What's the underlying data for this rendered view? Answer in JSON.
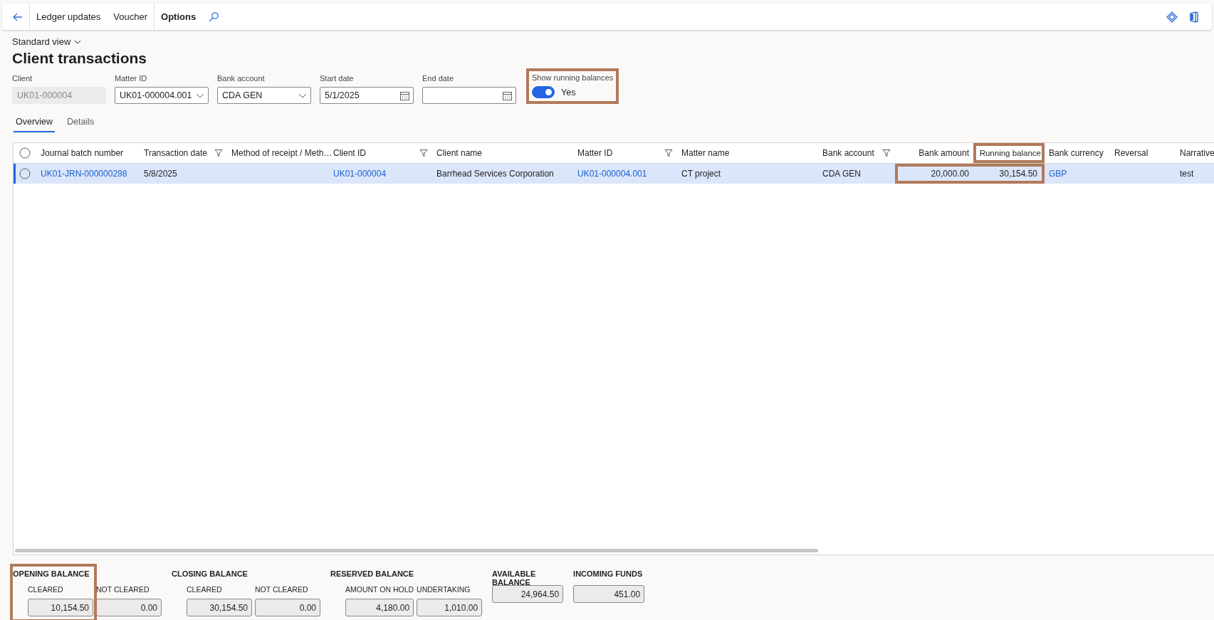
{
  "toolbar": {
    "items": [
      {
        "label": "Ledger updates",
        "kind": "action"
      },
      {
        "label": "Voucher",
        "kind": "action"
      },
      {
        "label": "Options",
        "kind": "menu"
      }
    ]
  },
  "view": {
    "label": "Standard view"
  },
  "title": "Client transactions",
  "filters": [
    {
      "label": "Client",
      "value": "UK01-000004",
      "kind": "readonly"
    },
    {
      "label": "Matter ID",
      "value": "UK01-000004.001",
      "kind": "dropdown"
    },
    {
      "label": "Bank account",
      "value": "CDA GEN",
      "kind": "dropdown"
    },
    {
      "label": "Start date",
      "value": "5/1/2025",
      "kind": "date"
    },
    {
      "label": "End date",
      "kind": "date"
    }
  ],
  "running_balances": {
    "label": "Show running balances",
    "on": true,
    "state_text": "Yes",
    "highlighted": true
  },
  "tabs": [
    {
      "label": "Overview",
      "selected": true
    },
    {
      "label": "Details",
      "selected": false
    }
  ],
  "table": {
    "all_selected": false,
    "columns": [
      {
        "label": "Journal batch number",
        "filter": false,
        "numeric": false,
        "highlighted": false
      },
      {
        "label": "Transaction date",
        "filter": true,
        "numeric": false,
        "highlighted": false
      },
      {
        "label": "Method of receipt / Meth…",
        "filter": false,
        "numeric": false,
        "highlighted": false
      },
      {
        "label": "Client ID",
        "filter": true,
        "numeric": false,
        "highlighted": false
      },
      {
        "label": "Client name",
        "filter": false,
        "numeric": false,
        "highlighted": false
      },
      {
        "label": "Matter ID",
        "filter": true,
        "numeric": false,
        "highlighted": false
      },
      {
        "label": "Matter name",
        "filter": false,
        "numeric": false,
        "highlighted": false
      },
      {
        "label": "Bank account",
        "filter": true,
        "numeric": false,
        "highlighted": false
      },
      {
        "label": "Bank amount",
        "filter": false,
        "numeric": true,
        "highlighted": false
      },
      {
        "label": "Running balance",
        "filter": false,
        "numeric": true,
        "highlighted": true
      },
      {
        "label": "Bank currency",
        "filter": false,
        "numeric": false,
        "highlighted": false
      },
      {
        "label": "Reversal",
        "filter": false,
        "numeric": false,
        "highlighted": false
      },
      {
        "label": "Narrative",
        "filter": false,
        "numeric": false,
        "highlighted": false
      }
    ],
    "rows": [
      {
        "selected": true,
        "cells": [
          {
            "text": "UK01-JRN-000000298",
            "link": true,
            "highlighted": false
          },
          {
            "text": "5/8/2025",
            "link": false,
            "highlighted": false
          },
          {
            "highlighted": false
          },
          {
            "text": "UK01-000004",
            "link": true,
            "highlighted": false
          },
          {
            "text": "Barrhead Services Corporation",
            "link": false,
            "highlighted": false
          },
          {
            "text": "UK01-000004.001",
            "link": true,
            "highlighted": false
          },
          {
            "text": "CT project",
            "link": false,
            "highlighted": false
          },
          {
            "text": "CDA GEN",
            "link": false,
            "highlighted": false
          },
          {
            "text": "20,000.00",
            "link": false,
            "highlighted": true
          },
          {
            "text": "30,154.50",
            "link": false,
            "highlighted": true
          },
          {
            "text": "GBP",
            "link": true,
            "highlighted": false
          },
          {
            "highlighted": false
          },
          {
            "text": "test",
            "link": false,
            "highlighted": false
          }
        ]
      }
    ]
  },
  "balances": [
    {
      "title": "OPENING BALANCE",
      "highlighted": true,
      "fields": [
        {
          "label": "CLEARED",
          "value": "10,154.50"
        },
        {
          "label": "NOT CLEARED",
          "value": "0.00"
        }
      ]
    },
    {
      "title": "CLOSING BALANCE",
      "highlighted": false,
      "fields": [
        {
          "label": "CLEARED",
          "value": "30,154.50"
        },
        {
          "label": "NOT CLEARED",
          "value": "0.00"
        }
      ]
    },
    {
      "title": "RESERVED BALANCE",
      "highlighted": false,
      "fields": [
        {
          "label": "AMOUNT ON HOLD",
          "value": "4,180.00"
        },
        {
          "label": "UNDERTAKING",
          "value": "1,010.00"
        }
      ]
    },
    {
      "title": "AVAILABLE BALANCE",
      "highlighted": false,
      "fields": [
        {
          "value": "24,964.50"
        }
      ]
    },
    {
      "title": "INCOMING FUNDS",
      "highlighted": false,
      "fields": [
        {
          "value": "451.00"
        }
      ]
    }
  ]
}
